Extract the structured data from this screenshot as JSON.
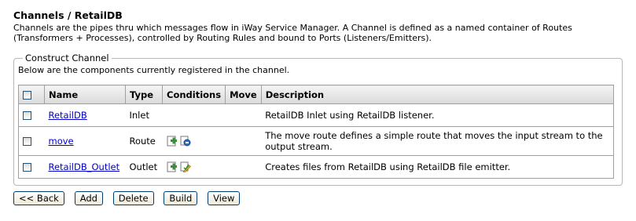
{
  "page": {
    "title": "Channels / RetailDB",
    "description": "Channels are the pipes thru which messages flow in iWay Service Manager. A Channel is defined as a named container of Routes (Transformers + Processes), controlled by Routing Rules and bound to Ports (Listeners/Emitters)."
  },
  "construct": {
    "legend": "Construct Channel",
    "intro": "Below are the components currently registered in the channel.",
    "columns": {
      "name": "Name",
      "type": "Type",
      "conditions": "Conditions",
      "move": "Move",
      "description": "Description"
    },
    "rows": [
      {
        "name": "RetailDB",
        "type": "Inlet",
        "description": "RetailDB Inlet using RetailDB listener.",
        "conditions": []
      },
      {
        "name": "move",
        "type": "Route",
        "description": "The move route defines a simple route that moves the input stream to the output stream.",
        "conditions": [
          "add-condition-icon",
          "process-condition-icon"
        ]
      },
      {
        "name": "RetailDB_Outlet",
        "type": "Outlet",
        "description": "Creates files from RetailDB using RetailDB file emitter.",
        "conditions": [
          "add-condition-icon",
          "edit-condition-icon"
        ]
      }
    ]
  },
  "buttons": {
    "back": "<< Back",
    "add": "Add",
    "delete": "Delete",
    "build": "Build",
    "view": "View"
  },
  "colors": {
    "link": "#0000cc",
    "header_bg": "#dadada",
    "border": "#a0a0a0"
  }
}
